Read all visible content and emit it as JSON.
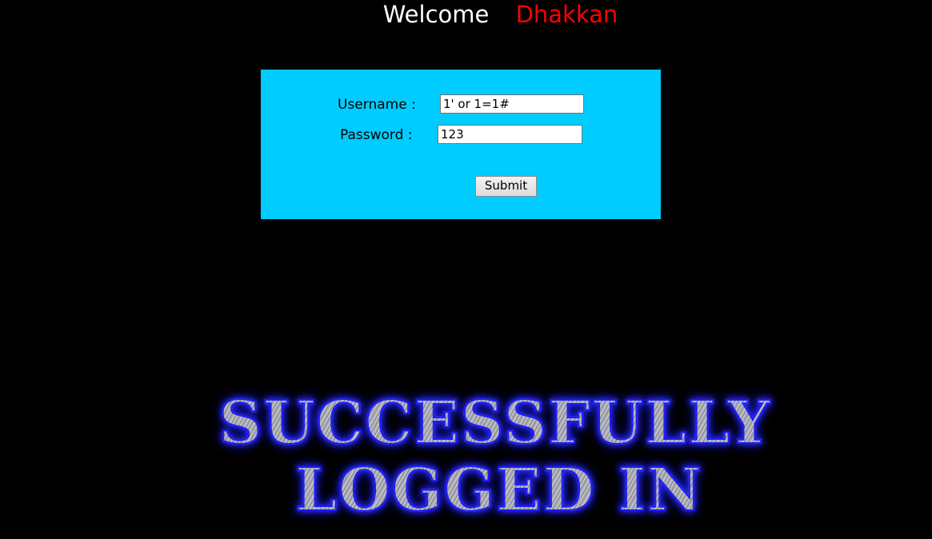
{
  "header": {
    "welcome_label": "Welcome",
    "user_name": "Dhakkan"
  },
  "login_form": {
    "username_label": "Username :",
    "username_value": "1' or 1=1#",
    "password_label": "Password :",
    "password_value": "123",
    "submit_label": "Submit"
  },
  "result": {
    "line1": "SUCCESSFULLY",
    "line2": "LOGGED IN"
  },
  "colors": {
    "background": "#000000",
    "form_background": "#00ccff",
    "welcome_text": "#ffffff",
    "user_name_text": "#ff0000",
    "success_glow": "#1a1aff"
  }
}
